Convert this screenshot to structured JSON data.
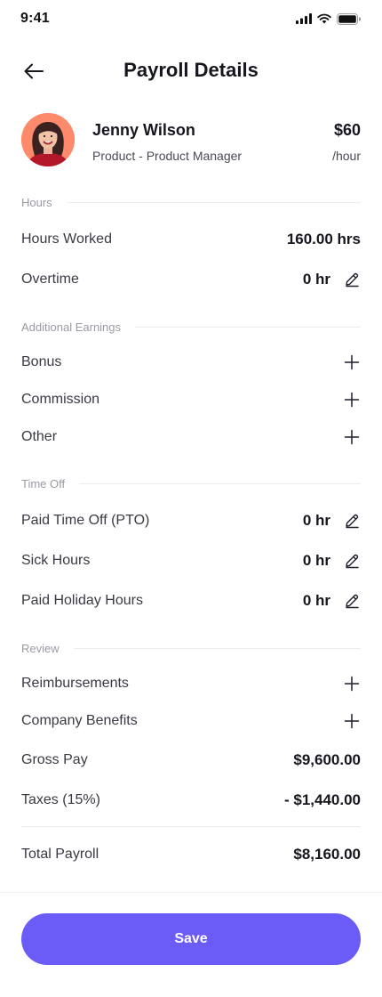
{
  "status_bar": {
    "time": "9:41"
  },
  "header": {
    "title": "Payroll Details"
  },
  "employee": {
    "name": "Jenny Wilson",
    "role": "Product - Product Manager",
    "rate": "$60",
    "rate_unit": "/hour"
  },
  "sections": {
    "hours": "Hours",
    "additional_earnings": "Additional Earnings",
    "time_off": "Time Off",
    "review": "Review"
  },
  "hours": {
    "worked_label": "Hours Worked",
    "worked_value": "160.00 hrs",
    "overtime_label": "Overtime",
    "overtime_value": "0 hr"
  },
  "additional_earnings": {
    "bonus_label": "Bonus",
    "commission_label": "Commission",
    "other_label": "Other"
  },
  "time_off": {
    "pto_label": "Paid Time Off (PTO)",
    "pto_value": "0 hr",
    "sick_label": "Sick Hours",
    "sick_value": "0 hr",
    "holiday_label": "Paid Holiday Hours",
    "holiday_value": "0 hr"
  },
  "review": {
    "reimbursements_label": "Reimbursements",
    "benefits_label": "Company Benefits",
    "gross_label": "Gross Pay",
    "gross_value": "$9,600.00",
    "taxes_label": "Taxes (15%)",
    "taxes_value": "- $1,440.00",
    "total_label": "Total Payroll",
    "total_value": "$8,160.00"
  },
  "actions": {
    "save_label": "Save"
  },
  "colors": {
    "primary": "#6c5cf7",
    "avatar_bg": "#ff8a6b",
    "text_dark": "#16161f",
    "text_muted": "#9a9aa4"
  },
  "icons": [
    "back-arrow-icon",
    "signal-icon",
    "wifi-icon",
    "battery-icon",
    "pencil-icon",
    "plus-icon"
  ]
}
